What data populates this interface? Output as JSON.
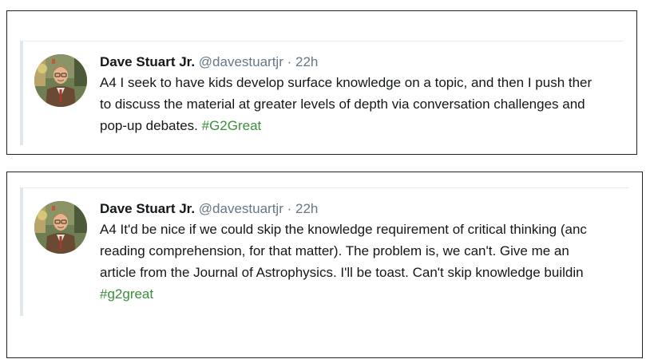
{
  "tweets": [
    {
      "author": "Dave Stuart Jr.",
      "handle": "@davestuartjr",
      "separator": "·",
      "time": "22h",
      "lines": [
        "A4 I seek to have kids develop surface knowledge on a topic, and then I push ther",
        "to discuss the material at greater levels of depth via conversation challenges and",
        "pop-up debates."
      ],
      "hashtag": "#G2Great"
    },
    {
      "author": "Dave Stuart Jr.",
      "handle": "@davestuartjr",
      "separator": "·",
      "time": "22h",
      "lines": [
        "A4 It'd be nice if we could skip the knowledge requirement of critical thinking (anc",
        "reading comprehension, for that matter). The problem is, we can't. Give me an",
        "article from the Journal of Astrophysics. I'll be toast. Can't skip knowledge buildin"
      ],
      "hashtag": "#g2great"
    }
  ],
  "colors": {
    "name": "#14171a",
    "meta": "#657786",
    "hashtag": "#3b8e3b",
    "divider": "#e1e8ed"
  },
  "icons": {
    "avatar": "author-avatar-photo"
  }
}
